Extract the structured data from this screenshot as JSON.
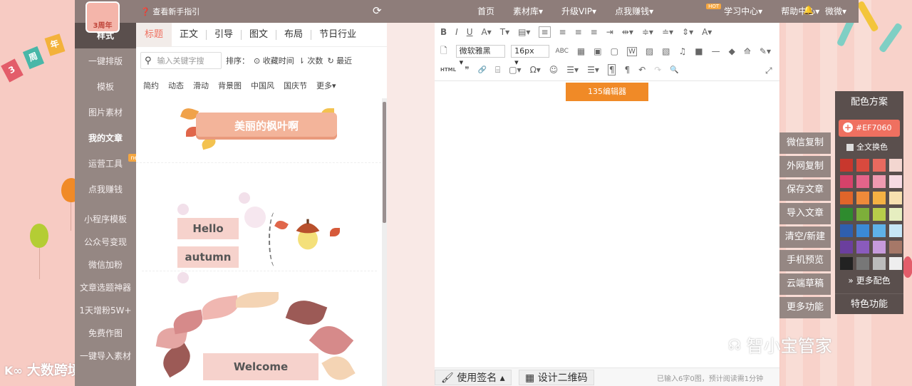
{
  "topbar": {
    "guide": "查看新手指引",
    "nav": [
      {
        "label": "首页"
      },
      {
        "label": "素材库▾"
      },
      {
        "label": "升级VIP▾"
      },
      {
        "label": "点我赚钱▾",
        "badge": "HOT"
      },
      {
        "label": "学习中心▾"
      },
      {
        "label": "帮助中心▾"
      }
    ],
    "user": "微微▾"
  },
  "logo": {
    "text": "3周年"
  },
  "anniversary_flags": [
    "3",
    "周",
    "年"
  ],
  "sidebar": {
    "items": [
      {
        "label": "样式",
        "state": "active"
      },
      {
        "label": "一键排版"
      },
      {
        "label": "模板"
      },
      {
        "label": "图片素材"
      },
      {
        "label": "我的文章",
        "state": "bold"
      },
      {
        "label": "运营工具",
        "badge": "new"
      },
      {
        "label": "点我赚钱"
      },
      {
        "label": "小程序模板"
      },
      {
        "label": "公众号变现"
      },
      {
        "label": "微信加粉"
      },
      {
        "label": "文章选题神器"
      },
      {
        "label": "1天增粉5W+"
      },
      {
        "label": "免费作图"
      },
      {
        "label": "一键导入素材"
      }
    ]
  },
  "panel": {
    "tabs": [
      "标题",
      "正文",
      "引导",
      "图文",
      "布局",
      "节日行业"
    ],
    "search": {
      "placeholder": "输入关键字搜"
    },
    "sort_label": "排序：",
    "sort_options": [
      "⊙ 收藏时间",
      "⇂ 次数",
      "↻ 最近"
    ],
    "categories": [
      "简约",
      "动态",
      "滑动",
      "背景图",
      "中国风",
      "国庆节",
      "更多▾"
    ],
    "samples": {
      "title_banner": "美丽的枫叶啊",
      "hello": "Hello",
      "autumn": "autumn",
      "welcome": "Welcome"
    }
  },
  "editor": {
    "toolbar_row1": [
      "B",
      "I",
      "U",
      "A▾",
      "T▾",
      "▤▾",
      "≡",
      "≡",
      "≡",
      "≡",
      "⇥",
      "⇹▾",
      "≑▾",
      "≐▾",
      "⇕▾",
      "A▾"
    ],
    "font_family": "微软雅黑",
    "font_size": "16px",
    "toolbar_row2": [
      "ABC",
      "▦",
      "▣",
      "▢",
      "W",
      "▨",
      "▧",
      "♫",
      "■",
      "—",
      "◆",
      "⟰",
      "✎▾"
    ],
    "toolbar_row3": [
      "HTML",
      "❞",
      "🔗",
      "⌸",
      "▢▾",
      "Ω▾",
      "☺",
      "☰▾",
      "☰▾",
      "¶",
      "¶",
      "↶",
      "↷",
      "🔍"
    ],
    "tag": "135编辑器",
    "bottom": {
      "signature": "使用签名 ▴",
      "qrcode": "设计二维码",
      "status": "已输入6字0图，预计阅读需1分钟"
    }
  },
  "actions": [
    "微信复制",
    "外网复制",
    "保存文章",
    "导入文章",
    "清空/新建",
    "手机预览",
    "云端草稿",
    "更多功能"
  ],
  "color_panel": {
    "title": "配色方案",
    "current_color": "#EF7060",
    "full_text_label": "全文换色",
    "swatches": [
      "#c8372d",
      "#d94a3e",
      "#e86a5f",
      "#f3d6d0",
      "#d6426a",
      "#e4648a",
      "#ef9ab0",
      "#f7dbe3",
      "#e0652a",
      "#ee8a3a",
      "#f4b143",
      "#f7e0b0",
      "#2e8b2e",
      "#7dae3a",
      "#b7cd4a",
      "#e6eec0",
      "#2f5fae",
      "#3b8ad6",
      "#5fb2e8",
      "#c6e6f6",
      "#6b3f9e",
      "#8a5bbd",
      "#c69bdc",
      "#a67868",
      "#222222",
      "#777777",
      "#bbbbbb",
      "#eeeeee"
    ],
    "more_label": "更多配色",
    "special_label": "特色功能"
  },
  "watermarks": {
    "bottom_left": "大数跨境",
    "bottom_right": "智小宝管家"
  }
}
